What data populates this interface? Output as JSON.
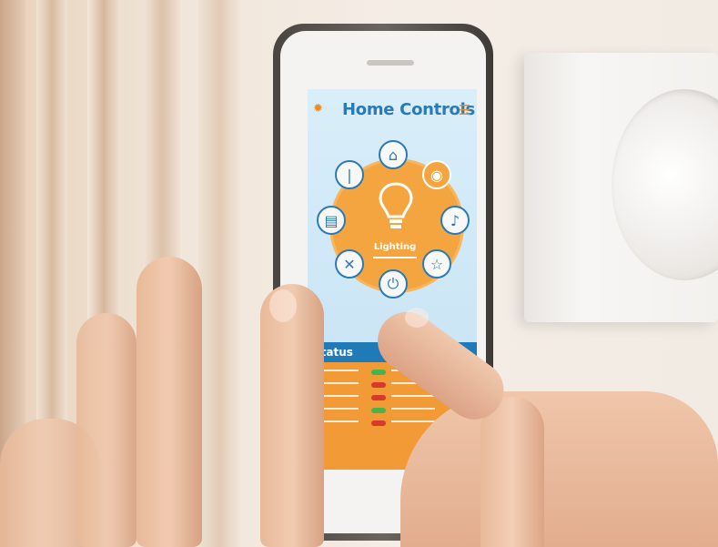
{
  "screen": {
    "title": "Home Controls",
    "icons": {
      "settings": "gear-icon",
      "menu": "hamburger-menu-icon"
    },
    "hub": {
      "label": "Lighting",
      "icon": "lightbulb-icon"
    },
    "nodes": [
      {
        "name": "home",
        "icon": "house-icon"
      },
      {
        "name": "lighting",
        "icon": "bulb-icon"
      },
      {
        "name": "music",
        "icon": "music-note-icon"
      },
      {
        "name": "favorites",
        "icon": "star-icon"
      },
      {
        "name": "power",
        "icon": "power-icon"
      },
      {
        "name": "tools",
        "icon": "tools-icon"
      },
      {
        "name": "appliances",
        "icon": "appliance-icon"
      },
      {
        "name": "temperature",
        "icon": "thermometer-icon"
      }
    ],
    "status": {
      "title": "Status"
    }
  },
  "colors": {
    "accent_blue": "#2a7ab8",
    "accent_orange": "#f29a35",
    "toggle_on": "#48b34a",
    "toggle_off": "#d63a2a"
  }
}
